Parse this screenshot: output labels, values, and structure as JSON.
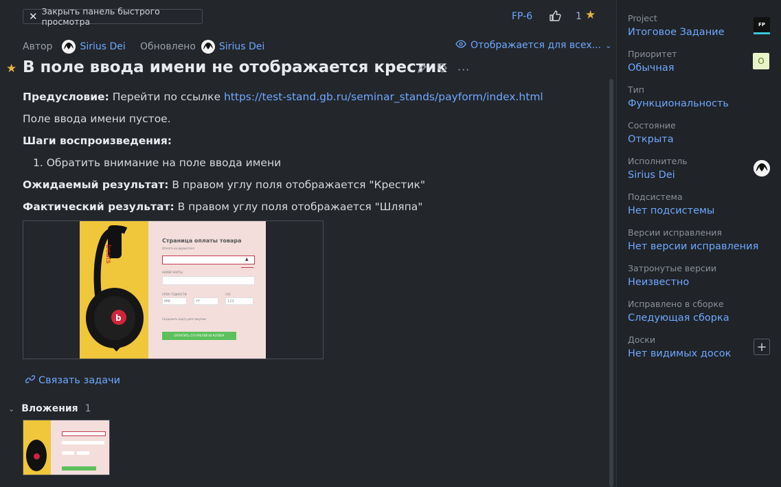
{
  "header": {
    "close_panel": "Закрыть панель быстрого просмотра",
    "issue_key": "FP-6",
    "votes": "1"
  },
  "meta": {
    "author_label": "Автор",
    "author": "Sirius Dei",
    "updated_label": "Обновлено",
    "updater": "Sirius Dei",
    "visibility": "Отображается для всех..."
  },
  "issue": {
    "title": "В поле ввода имени не отображается крестик",
    "precondition_label": "Предусловие:",
    "precondition_text": "Перейти по ссылке",
    "precondition_link": "https://test-stand.gb.ru/seminar_stands/payform/index.html",
    "line2": "Поле ввода имени пустое.",
    "steps_label": "Шаги воспроизведения:",
    "step1": "1. Обратить внимание на поле ввода имени",
    "expected_label": "Ожидаемый результат:",
    "expected_text": "В правом углу поля отображается \"Крестик\"",
    "actual_label": "Фактический результат:",
    "actual_text": "В правом углу поля отображается \"Шляпа\"",
    "screenshot": {
      "form_title": "Страница оплаты товара",
      "field_hint": "Оплата на держателя",
      "card_label": "НОМЕР КАРТЫ",
      "expiry_label": "СРОК ГОДНОСТИ",
      "cvc_label": "CVC",
      "mm": "MM",
      "yy": "YY",
      "cvc_value": "123",
      "save_card": "Сохранить карту для покупки",
      "pay_button": "ОПЛАТИТЬ 570 РУБЛЕЙ 60 КОПЕЕК"
    }
  },
  "links": {
    "link_issues": "Связать задачи"
  },
  "attachments": {
    "label": "Вложения",
    "count": "1"
  },
  "sidebar": {
    "project_label": "Project",
    "project": "Итоговое Задание",
    "project_icon": "FP",
    "priority_label": "Приоритет",
    "priority": "Обычная",
    "priority_icon": "O",
    "type_label": "Тип",
    "type": "Функциональность",
    "state_label": "Состояние",
    "state": "Открыта",
    "assignee_label": "Исполнитель",
    "assignee": "Sirius Dei",
    "subsystem_label": "Подсистема",
    "subsystem": "Нет подсистемы",
    "fix_versions_label": "Версии исправления",
    "fix_versions": "Нет версии исправления",
    "affected_label": "Затронутые версии",
    "affected": "Неизвестно",
    "fixed_build_label": "Исправлено в сборке",
    "fixed_build": "Следующая сборка",
    "boards_label": "Доски",
    "boards": "Нет видимых досок"
  },
  "colors": {
    "accent": "#6ea8ff",
    "star": "#e3b341",
    "background": "#23262b"
  }
}
